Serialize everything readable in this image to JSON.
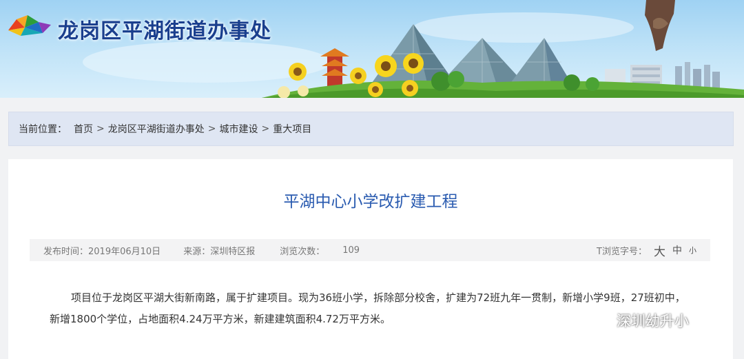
{
  "header": {
    "site_title": "龙岗区平湖街道办事处"
  },
  "breadcrumb": {
    "label": "当前位置：",
    "items": [
      "首页",
      "龙岗区平湖街道办事处",
      "城市建设",
      "重大项目"
    ],
    "separator": ">"
  },
  "article": {
    "title": "平湖中心小学改扩建工程",
    "meta": {
      "publish_label": "发布时间：",
      "publish_date": "2019年06月10日",
      "source_label": "来源：",
      "source": "深圳特区报",
      "views_label": "浏览次数：",
      "views": "109",
      "font_size_label": "T浏览字号：",
      "font_large": "大",
      "font_medium": "中",
      "font_small": "小"
    },
    "body": "项目位于龙岗区平湖大街新南路，属于扩建项目。现为36班小学，拆除部分校舍，扩建为72班九年一贯制，新增小学9班，27班初中，新增1800个学位，占地面积4.24万平方米，新建建筑面积4.72万平方米。"
  },
  "watermark": {
    "text": "深圳幼升小",
    "icon": "wechat-icon"
  },
  "colors": {
    "title_blue": "#2a5bb0",
    "site_title_blue": "#1a3f8e",
    "breadcrumb_bg": "#dfe6f3",
    "meta_bg": "#f3f3f4"
  }
}
